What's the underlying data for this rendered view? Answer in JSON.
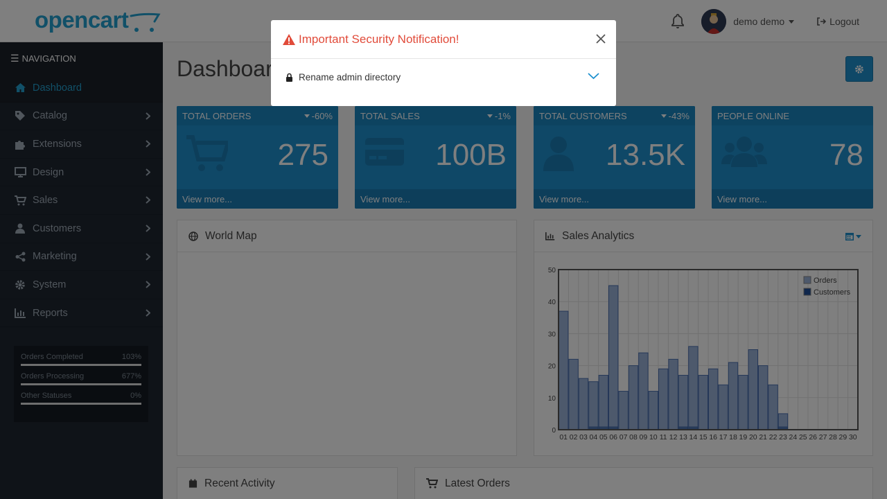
{
  "header": {
    "logo": "opencart",
    "user_name": "demo demo",
    "logout_label": "Logout"
  },
  "sidebar": {
    "title": "NAVIGATION",
    "items": [
      {
        "label": "Dashboard",
        "icon": "home-icon"
      },
      {
        "label": "Catalog",
        "icon": "tag-icon"
      },
      {
        "label": "Extensions",
        "icon": "puzzle-icon"
      },
      {
        "label": "Design",
        "icon": "monitor-icon"
      },
      {
        "label": "Sales",
        "icon": "cart-icon"
      },
      {
        "label": "Customers",
        "icon": "user-icon"
      },
      {
        "label": "Marketing",
        "icon": "share-icon"
      },
      {
        "label": "System",
        "icon": "gear-icon"
      },
      {
        "label": "Reports",
        "icon": "bar-chart-icon"
      }
    ],
    "stats": [
      {
        "label": "Orders Completed",
        "value": "103%"
      },
      {
        "label": "Orders Processing",
        "value": "677%"
      },
      {
        "label": "Other Statuses",
        "value": "0%"
      }
    ]
  },
  "main": {
    "title": "Dashboard",
    "tiles": [
      {
        "title": "TOTAL ORDERS",
        "change": "-60%",
        "value": "275",
        "link": "View more...",
        "icon": "cart-icon"
      },
      {
        "title": "TOTAL SALES",
        "change": "-1%",
        "value": "100B",
        "link": "View more...",
        "icon": "credit-card-icon"
      },
      {
        "title": "TOTAL CUSTOMERS",
        "change": "-43%",
        "value": "13.5K",
        "link": "View more...",
        "icon": "user-icon"
      },
      {
        "title": "PEOPLE ONLINE",
        "change": "",
        "value": "78",
        "link": "View more...",
        "icon": "users-icon"
      }
    ],
    "world_map_title": "World Map",
    "sales_title": "Sales Analytics",
    "recent_title": "Recent Activity",
    "orders_title": "Latest Orders"
  },
  "modal": {
    "title": "Important Security Notification!",
    "item": "Rename admin directory"
  },
  "colors": {
    "accent": "#1e91cf",
    "sidebar": "#1f2630",
    "danger": "#e14b3a"
  },
  "chart_data": {
    "type": "bar",
    "categories": [
      "01",
      "02",
      "03",
      "04",
      "05",
      "06",
      "07",
      "08",
      "09",
      "10",
      "11",
      "12",
      "13",
      "14",
      "15",
      "16",
      "17",
      "18",
      "19",
      "20",
      "21",
      "22",
      "23",
      "24",
      "25",
      "26",
      "27",
      "28",
      "29",
      "30"
    ],
    "series": [
      {
        "name": "Orders",
        "values": [
          37,
          22,
          16,
          15,
          17,
          45,
          12,
          20,
          24,
          12,
          19,
          22,
          17,
          26,
          17,
          19,
          14,
          21,
          17,
          25,
          20,
          14,
          5,
          0,
          0,
          0,
          0,
          0,
          0,
          0
        ]
      },
      {
        "name": "Customers",
        "values": [
          0,
          0,
          0,
          1,
          1,
          1,
          0,
          0,
          0,
          0,
          0,
          0,
          1,
          1,
          0,
          0,
          0,
          0,
          0,
          0,
          0,
          0,
          1,
          0,
          0,
          0,
          0,
          0,
          0,
          0
        ]
      }
    ],
    "ylim": [
      0,
      50
    ],
    "yticks": [
      0,
      10,
      20,
      30,
      40,
      50
    ],
    "grid": true,
    "legend": "top-right"
  }
}
